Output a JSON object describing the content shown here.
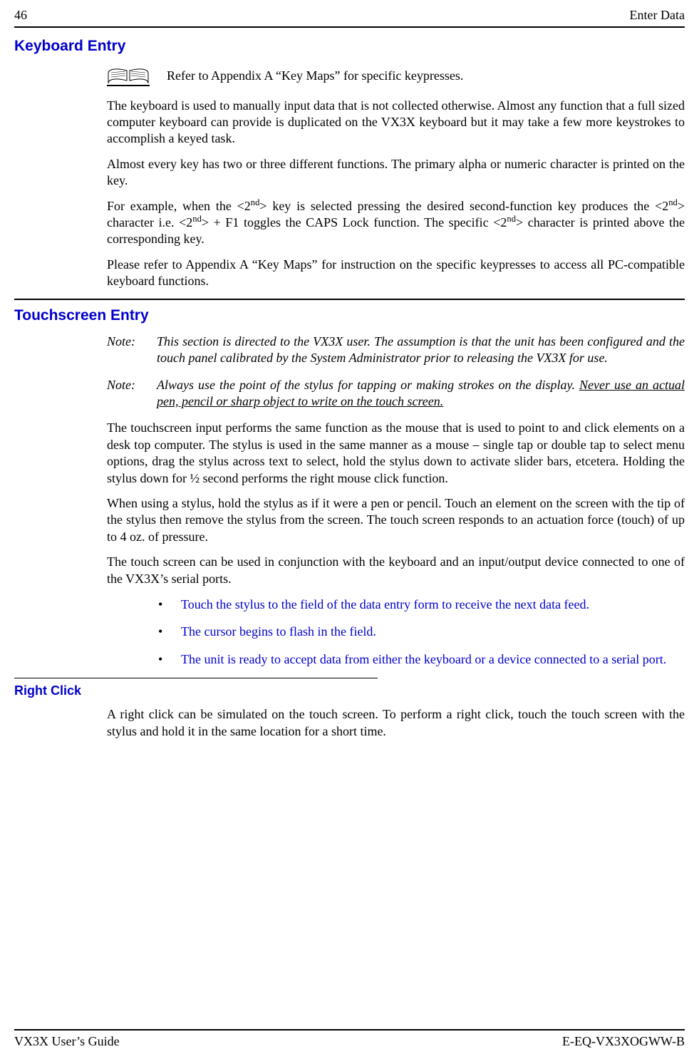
{
  "header": {
    "pageNumber": "46",
    "chapterTitle": "Enter Data"
  },
  "section1": {
    "heading": "Keyboard Entry",
    "referText": "Refer to Appendix A “Key Maps” for specific keypresses.",
    "p1": "The keyboard is used to manually input data that is not collected otherwise. Almost any function that a full sized computer keyboard can provide is duplicated on the VX3X keyboard but it may take a few more keystrokes to accomplish a keyed task.",
    "p2": "Almost every key has two or three different functions. The primary alpha or numeric character is printed on the key.",
    "p3_a": "For example, when the <2",
    "p3_b": "> key is selected pressing the desired second-function key produces the <2",
    "p3_c": "> character i.e. <2",
    "p3_d": "> + F1 toggles the CAPS Lock function. The specific <2",
    "p3_e": "> character is printed above the corresponding key.",
    "nd": "nd",
    "p4": "Please refer to Appendix A “Key Maps” for instruction on the specific keypresses to access all PC-compatible keyboard functions."
  },
  "section2": {
    "heading": "Touchscreen Entry",
    "noteLabel": "Note:",
    "note1": "This section is directed to the VX3X user. The assumption is that the unit has been configured and the touch panel calibrated by the System Administrator prior to releasing the VX3X for use.",
    "note2a": "Always use the point of the stylus for tapping or making strokes on the display. Never use an actual pen, pencil or sharp object to write on the touch screen.",
    "p1": "The touchscreen input performs the same function as the mouse that is used to point to and click elements on a desk top computer. The stylus is used in the same manner as a mouse – single tap or double tap to select menu options, drag the stylus across text to select, hold the stylus down to activate slider bars, etcetera.  Holding the stylus down for ½ second performs the right mouse click function.",
    "p2": "When using a stylus, hold the stylus as if it were a pen or pencil. Touch an element on the screen with the tip of the stylus then remove the stylus from the screen. The touch screen responds to an actuation force (touch) of up to 4 oz. of pressure.",
    "p3": "The touch screen can be used in conjunction with the keyboard and an input/output device connected to one of the VX3X’s serial ports.",
    "bullets": [
      "Touch the stylus to the field of the data entry form to receive the next data feed.",
      "The cursor begins to flash in the field.",
      "The unit is ready to accept data from either the keyboard or a device connected to a serial port."
    ]
  },
  "section3": {
    "heading": "Right Click",
    "p1": "A right click can be simulated on the touch screen.  To perform a right click, touch the touch screen with the stylus and hold it in the same location for a short time."
  },
  "footer": {
    "left": "VX3X User’s Guide",
    "right": "E-EQ-VX3XOGWW-B"
  }
}
